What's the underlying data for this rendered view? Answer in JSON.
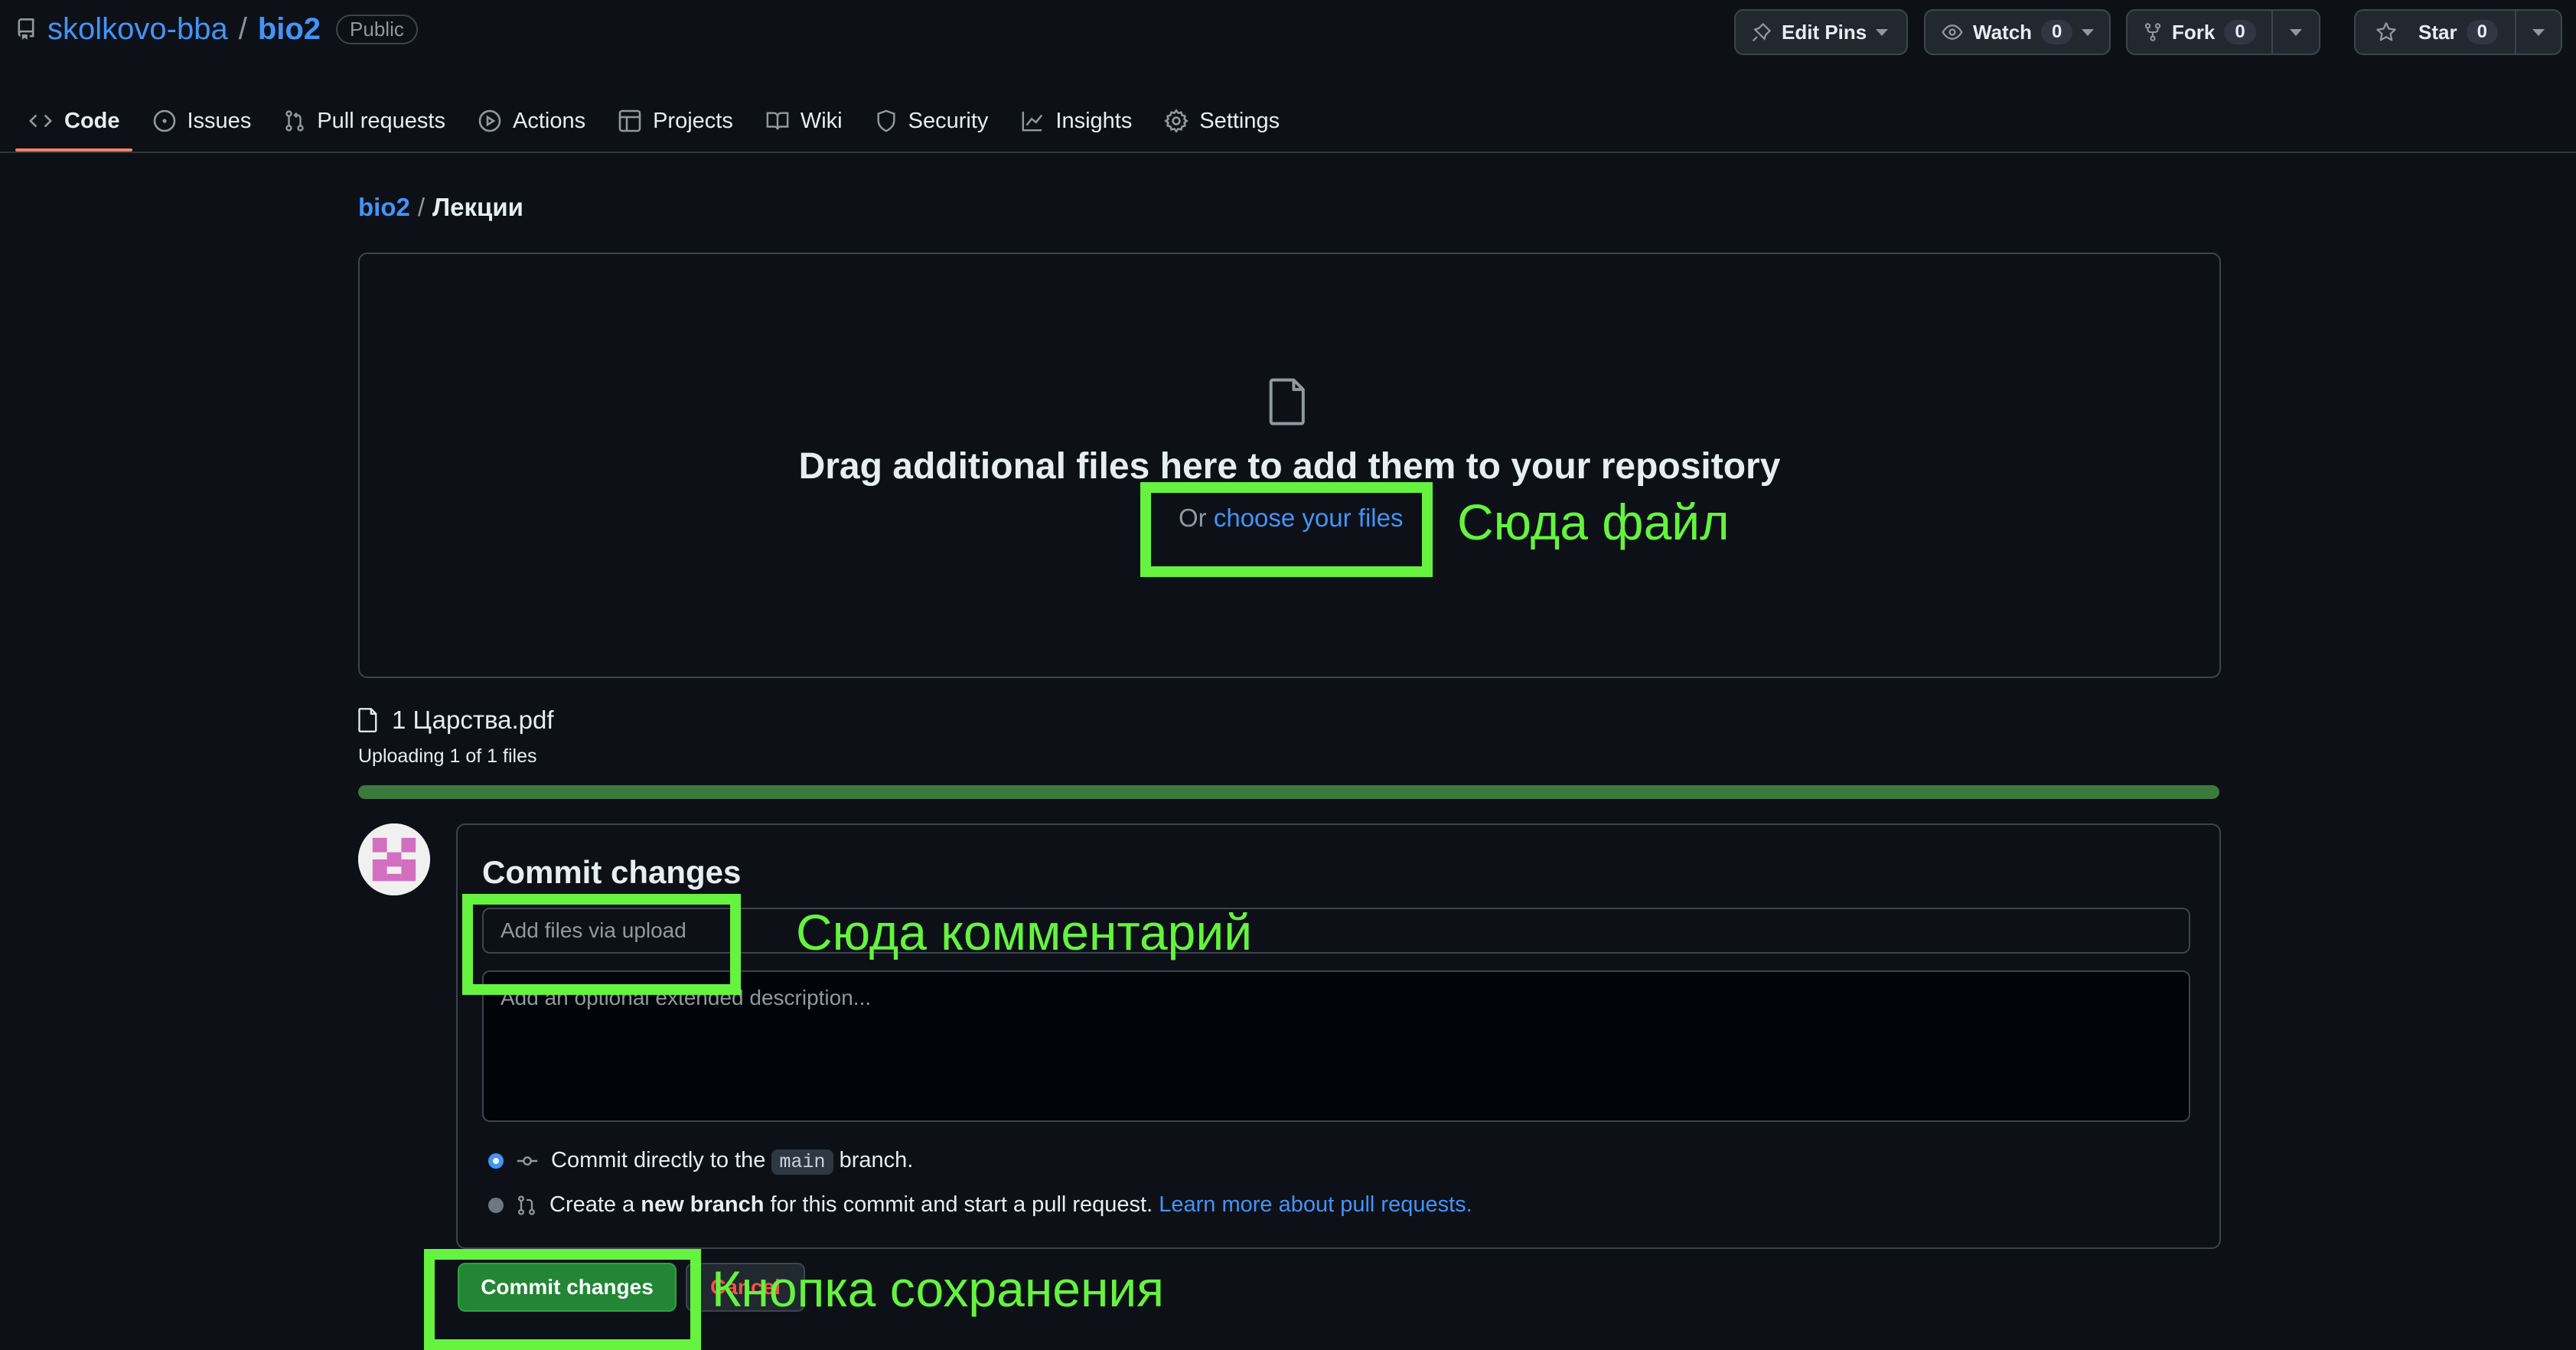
{
  "repo_header": {
    "owner": "skolkovo-bba",
    "separator": "/",
    "repo": "bio2",
    "visibility": "Public",
    "edit_pins_label": "Edit Pins",
    "watch_label": "Watch",
    "watch_count": "0",
    "fork_label": "Fork",
    "fork_count": "0",
    "star_label": "Star",
    "star_count": "0"
  },
  "tabs": [
    {
      "label": "Code",
      "icon": "code-icon",
      "selected": true
    },
    {
      "label": "Issues",
      "icon": "issue-opened-icon"
    },
    {
      "label": "Pull requests",
      "icon": "git-pull-request-icon"
    },
    {
      "label": "Actions",
      "icon": "play-icon"
    },
    {
      "label": "Projects",
      "icon": "table-icon"
    },
    {
      "label": "Wiki",
      "icon": "book-icon"
    },
    {
      "label": "Security",
      "icon": "shield-icon"
    },
    {
      "label": "Insights",
      "icon": "graph-icon"
    },
    {
      "label": "Settings",
      "icon": "gear-icon"
    }
  ],
  "breadcrumb": {
    "repo": "bio2",
    "separator": "/",
    "folder": "Лекции"
  },
  "dropzone": {
    "title": "Drag additional files here to add them to your repository",
    "or_text": "Or",
    "choose_link": "choose your files"
  },
  "files": {
    "name": "1 Царства.pdf",
    "status": "Uploading 1 of 1 files",
    "progress": 1.0
  },
  "commit": {
    "title": "Commit changes",
    "summary_placeholder": "Add files via upload",
    "description_placeholder": "Add an optional extended description...",
    "option_direct_prefix": "Commit directly to the",
    "branch_name": "main",
    "option_direct_suffix": "branch.",
    "option_new_prefix": "Create a",
    "option_new_bold": "new branch",
    "option_new_suffix": "for this commit and start a pull request.",
    "learn_more_link": "Learn more about pull requests.",
    "commit_button": "Commit changes",
    "cancel_button": "Cancel"
  },
  "annotations": {
    "file_hint": "Сюда файл",
    "comment_hint": "Сюда комментарий",
    "save_hint": "Кнопка сохранения",
    "color": "#65f33f"
  },
  "colors": {
    "background": "#0d1117",
    "link": "#4493f8",
    "tab_underline": "#f78166",
    "progress": "#3c7a3b",
    "commit_button": "#238636"
  }
}
